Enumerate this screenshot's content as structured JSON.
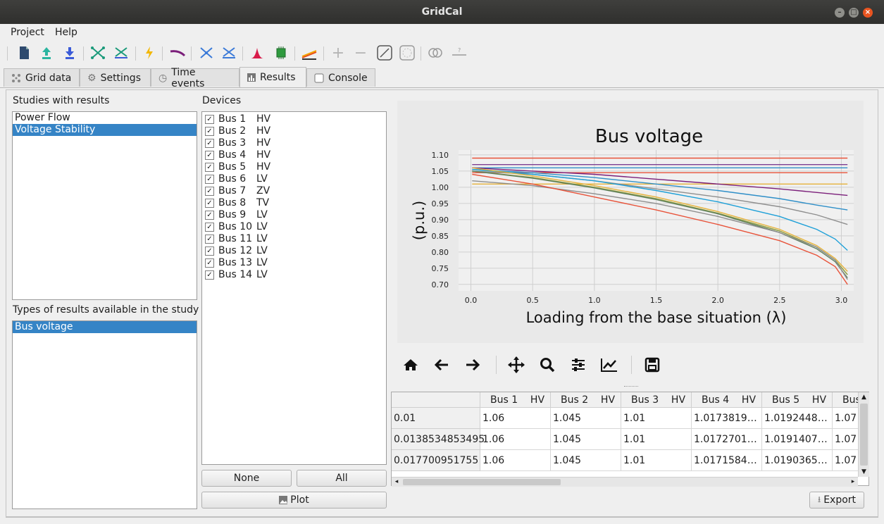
{
  "window": {
    "title": "GridCal"
  },
  "menu": [
    "Project",
    "Help"
  ],
  "tabs": [
    {
      "label": "Grid data",
      "icon": "grid-icon"
    },
    {
      "label": "Settings",
      "icon": "gear-icon"
    },
    {
      "label": "Time events",
      "icon": "clock-icon"
    },
    {
      "label": "Results",
      "icon": "chart-icon",
      "active": true
    },
    {
      "label": "Console",
      "icon": "console-icon"
    }
  ],
  "studies": {
    "label": "Studies with results",
    "items": [
      "Power Flow",
      "Voltage Stability"
    ],
    "selected": "Voltage Stability"
  },
  "result_types": {
    "label": "Types of results available in the study",
    "items": [
      "Bus voltage"
    ],
    "selected": "Bus voltage"
  },
  "devices": {
    "label": "Devices",
    "items": [
      {
        "name": "Bus 1",
        "type": "HV",
        "checked": true
      },
      {
        "name": "Bus 2",
        "type": "HV",
        "checked": true
      },
      {
        "name": "Bus 3",
        "type": "HV",
        "checked": true
      },
      {
        "name": "Bus 4",
        "type": "HV",
        "checked": true
      },
      {
        "name": "Bus 5",
        "type": "HV",
        "checked": true
      },
      {
        "name": "Bus 6",
        "type": "LV",
        "checked": true
      },
      {
        "name": "Bus 7",
        "type": "ZV",
        "checked": true
      },
      {
        "name": "Bus 8",
        "type": "TV",
        "checked": true
      },
      {
        "name": "Bus 9",
        "type": "LV",
        "checked": true
      },
      {
        "name": "Bus 10",
        "type": "LV",
        "checked": true
      },
      {
        "name": "Bus 11",
        "type": "LV",
        "checked": true
      },
      {
        "name": "Bus 12",
        "type": "LV",
        "checked": true
      },
      {
        "name": "Bus 13",
        "type": "LV",
        "checked": true
      },
      {
        "name": "Bus 14",
        "type": "LV",
        "checked": true
      }
    ],
    "check_mark": "✓"
  },
  "buttons": {
    "none": "None",
    "all": "All",
    "plot": "Plot",
    "export": "Export"
  },
  "chart_data": {
    "type": "line",
    "title": "Bus voltage",
    "xlabel": "Loading from the base situation (λ)",
    "ylabel": "(p.u.)",
    "xlim": [
      -0.1,
      3.1
    ],
    "ylim": [
      0.68,
      1.115
    ],
    "xticks": [
      "0.0",
      "0.5",
      "1.0",
      "1.5",
      "2.0",
      "2.5",
      "3.0"
    ],
    "yticks": [
      "0.70",
      "0.75",
      "0.80",
      "0.85",
      "0.90",
      "0.95",
      "1.00",
      "1.05",
      "1.10"
    ],
    "grid": true,
    "series": [
      {
        "color": "#e8533a",
        "x": [
          0.01,
          3.05
        ],
        "y": [
          1.09,
          1.09
        ]
      },
      {
        "color": "#7b3f91",
        "x": [
          0.01,
          3.05
        ],
        "y": [
          1.07,
          1.07
        ]
      },
      {
        "color": "#2f8fc8",
        "x": [
          0.01,
          3.05
        ],
        "y": [
          1.06,
          1.06
        ]
      },
      {
        "color": "#e8533a",
        "x": [
          0.01,
          3.05
        ],
        "y": [
          1.045,
          1.045
        ]
      },
      {
        "color": "#e6b23a",
        "x": [
          0.01,
          3.05
        ],
        "y": [
          1.01,
          1.01
        ]
      },
      {
        "color": "#7b1f7a",
        "x": [
          0.01,
          0.5,
          1.0,
          1.5,
          2.0,
          2.5,
          3.05
        ],
        "y": [
          1.06,
          1.05,
          1.04,
          1.025,
          1.01,
          0.995,
          0.975
        ]
      },
      {
        "color": "#2f8fc8",
        "x": [
          0.01,
          0.5,
          1.0,
          1.5,
          2.0,
          2.5,
          2.8,
          3.05
        ],
        "y": [
          1.055,
          1.045,
          1.03,
          1.01,
          0.99,
          0.965,
          0.945,
          0.93
        ]
      },
      {
        "color": "#8e8e8e",
        "x": [
          0.01,
          0.5,
          1.0,
          1.5,
          2.0,
          2.5,
          2.8,
          3.05
        ],
        "y": [
          1.05,
          1.04,
          1.02,
          0.995,
          0.97,
          0.94,
          0.915,
          0.885
        ]
      },
      {
        "color": "#1ea0d8",
        "x": [
          0.01,
          0.5,
          1.0,
          1.5,
          2.0,
          2.5,
          2.8,
          2.95,
          3.05
        ],
        "y": [
          1.055,
          1.04,
          1.02,
          0.99,
          0.955,
          0.91,
          0.87,
          0.84,
          0.805
        ]
      },
      {
        "color": "#e6b23a",
        "x": [
          0.01,
          0.5,
          1.0,
          1.5,
          2.0,
          2.5,
          2.8,
          2.95,
          3.05
        ],
        "y": [
          1.06,
          1.035,
          1.005,
          0.97,
          0.925,
          0.87,
          0.82,
          0.78,
          0.74
        ]
      },
      {
        "color": "#8a9a3a",
        "x": [
          0.01,
          0.5,
          1.0,
          1.5,
          2.0,
          2.5,
          2.8,
          2.95,
          3.05
        ],
        "y": [
          1.05,
          1.03,
          1.0,
          0.965,
          0.92,
          0.865,
          0.815,
          0.775,
          0.73
        ]
      },
      {
        "color": "#5f7f5f",
        "x": [
          0.01,
          0.5,
          1.0,
          1.5,
          2.0,
          2.5,
          2.8,
          2.95,
          3.05
        ],
        "y": [
          1.05,
          1.028,
          0.998,
          0.962,
          0.918,
          0.86,
          0.81,
          0.77,
          0.72
        ]
      },
      {
        "color": "#8e8e8e",
        "x": [
          0.01,
          0.5,
          1.0,
          1.5,
          2.0,
          2.5,
          2.8,
          2.95,
          3.05
        ],
        "y": [
          1.02,
          1.005,
          0.98,
          0.95,
          0.91,
          0.86,
          0.815,
          0.775,
          0.715
        ]
      },
      {
        "color": "#e8533a",
        "x": [
          0.01,
          0.5,
          1.0,
          1.5,
          2.0,
          2.5,
          2.8,
          2.95,
          3.05
        ],
        "y": [
          1.04,
          1.01,
          0.97,
          0.93,
          0.885,
          0.835,
          0.79,
          0.755,
          0.7
        ]
      }
    ]
  },
  "table": {
    "columns": [
      "Bus 1    HV",
      "Bus 2    HV",
      "Bus 3    HV",
      "Bus 4    HV",
      "Bus 5    HV",
      "Bus"
    ],
    "rows": [
      {
        "index": "0.01",
        "values": [
          "1.06",
          "1.045",
          "1.01",
          "1.0173819…",
          "1.0192448…",
          "1.07"
        ]
      },
      {
        "index": "0.0138534853495",
        "values": [
          "1.06",
          "1.045",
          "1.01",
          "1.0172701…",
          "1.0191407…",
          "1.07"
        ]
      },
      {
        "index": "0.017700951755",
        "values": [
          "1.06",
          "1.045",
          "1.01",
          "1.0171584…",
          "1.0190365…",
          "1.07"
        ]
      }
    ]
  }
}
